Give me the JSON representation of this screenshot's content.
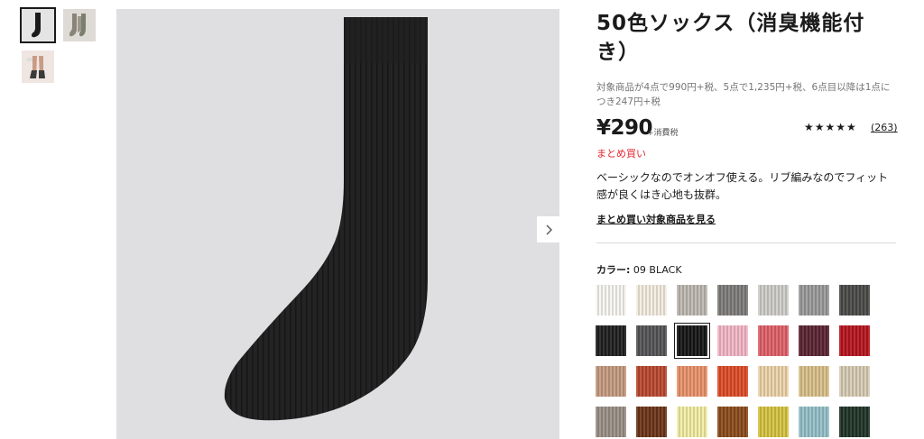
{
  "gallery": {
    "thumbnails": [
      {
        "name": "black-sock-thumb",
        "selected": true
      },
      {
        "name": "grey-socks-thumb",
        "selected": false
      },
      {
        "name": "model-legs-thumb",
        "selected": false
      }
    ],
    "next_icon": "chevron-right-icon"
  },
  "product": {
    "title": "50色ソックス（消臭機能付き）",
    "promo": "対象商品が4点で990円+税、5点で1,235円+税、6点目以降は1点につき247円+税",
    "price": "¥290",
    "tax_label": "+消費税",
    "rating_stars": "★★★★★",
    "rating_value": 4.5,
    "review_count": "(263)",
    "bundle_label": "まとめ買い",
    "description": "ベーシックなのでオンオフ使える。リブ編みなのでフィット感が良くはき心地も抜群。",
    "bundle_link": "まとめ買い対象商品を見る"
  },
  "color": {
    "label": "カラー:",
    "selected_name": "09 BLACK"
  },
  "swatch_colors": [
    [
      "#f7f6f1",
      "#f3ece0",
      "#bdb8b0",
      "#7d7c7a",
      "#cfcdc8",
      "#9a9a9a",
      "#4a4a48"
    ],
    [
      "#1f1f1f",
      "#545456",
      "#151515",
      "#f3b7c6",
      "#df6068",
      "#5b2332",
      "#b6141e"
    ],
    [
      "#c49a7f",
      "#b9472e",
      "#e9926a",
      "#dd4b27",
      "#ecd3a8",
      "#d9c08a",
      "#d7cbb3"
    ],
    [
      "#9a8f86",
      "#6b3316",
      "#f2eda4",
      "#8a4b1a",
      "#d5c341",
      "#94c0c7",
      "#1f3326"
    ]
  ],
  "selected_swatch": [
    1,
    2
  ]
}
